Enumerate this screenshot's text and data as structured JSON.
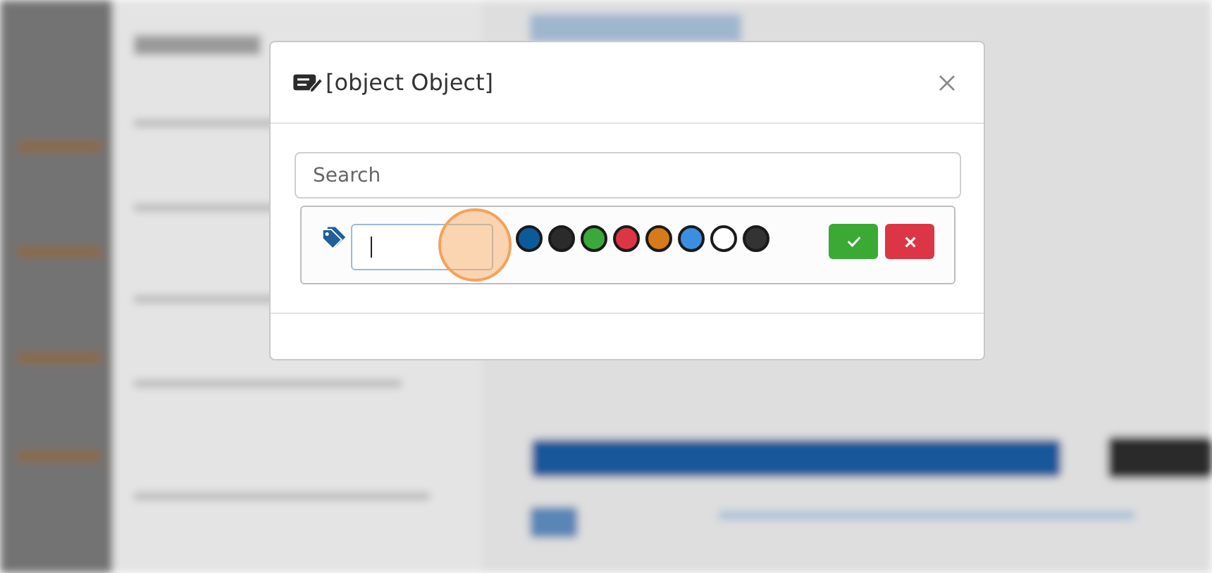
{
  "dialog": {
    "title": "[object Object]",
    "search": {
      "placeholder": "Search"
    },
    "tag_editor": {
      "colors": [
        {
          "color": "#0d5a9a"
        },
        {
          "color": "#2b2b2b"
        },
        {
          "color": "#3aa83a"
        },
        {
          "color": "#dc3545"
        },
        {
          "color": "#d67a1a"
        },
        {
          "color": "#3b8fe0"
        },
        {
          "color": "#ffffff"
        },
        {
          "color": "#333333"
        }
      ],
      "actions": [
        {
          "kind": "confirm"
        },
        {
          "kind": "cancel"
        }
      ]
    }
  }
}
